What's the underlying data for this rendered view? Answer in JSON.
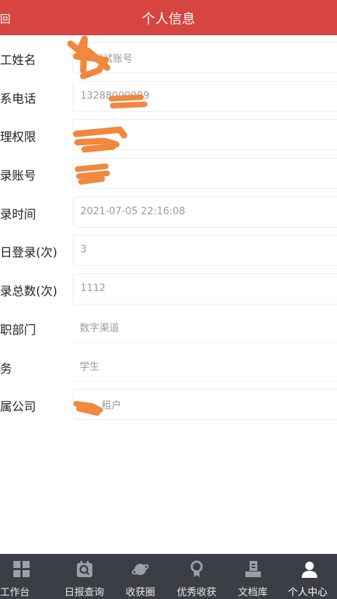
{
  "header": {
    "back_label": "回",
    "title": "个人信息"
  },
  "form": {
    "rows": [
      {
        "label": "工姓名",
        "value": "测试账号"
      },
      {
        "label": "系电话",
        "value": "13288000089"
      },
      {
        "label": "理权限",
        "value": ""
      },
      {
        "label": "录账号",
        "value": ""
      },
      {
        "label": "录时间",
        "value": "2021-07-05 22:16:08"
      },
      {
        "label": "日登录(次)",
        "value": "3"
      },
      {
        "label": "录总数(次)",
        "value": "1112"
      },
      {
        "label": "职部门",
        "value": "数字渠道"
      },
      {
        "label": "务",
        "value": "学生"
      },
      {
        "label": "属公司",
        "value": "租户"
      }
    ]
  },
  "tabbar": {
    "items": [
      {
        "label": "工作台",
        "icon": "grid-icon"
      },
      {
        "label": "日报查询",
        "icon": "report-search-icon"
      },
      {
        "label": "收获圈",
        "icon": "planet-icon"
      },
      {
        "label": "优秀收获",
        "icon": "award-icon"
      },
      {
        "label": "文档库",
        "icon": "document-stack-icon"
      },
      {
        "label": "个人中心",
        "icon": "user-icon"
      }
    ]
  },
  "colors": {
    "header_bg": "#d64540",
    "tabbar_bg": "#3b3f45",
    "scribble": "#f0883e"
  }
}
